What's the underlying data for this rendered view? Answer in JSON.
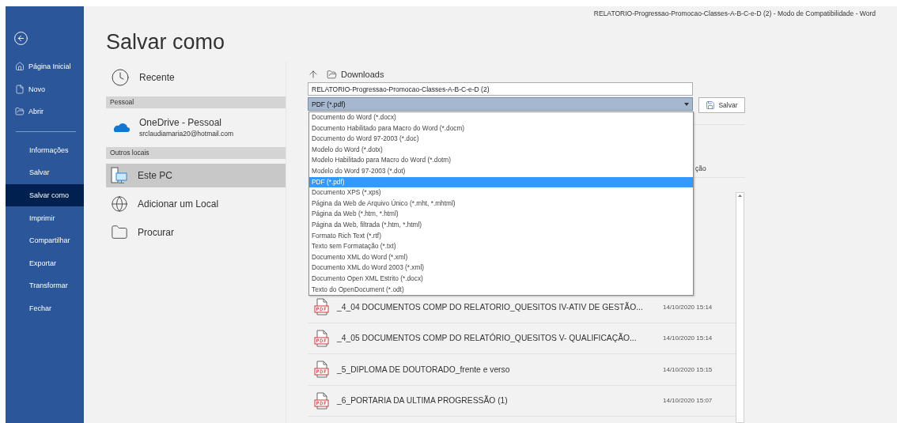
{
  "window": {
    "title": "RELATORIO-Progressao-Promocao-Classes-A-B-C-e-D (2)  -  Modo de Compatibilidade  -  Word"
  },
  "sidebar": {
    "top_items": [
      {
        "label": "Página Inicial",
        "kind": "home"
      },
      {
        "label": "Novo",
        "kind": "new"
      },
      {
        "label": "Abrir",
        "kind": "open"
      }
    ],
    "items": [
      {
        "label": "Informações",
        "selected": false
      },
      {
        "label": "Salvar",
        "selected": false
      },
      {
        "label": "Salvar como",
        "selected": true
      },
      {
        "label": "Imprimir",
        "selected": false
      },
      {
        "label": "Compartilhar",
        "selected": false
      },
      {
        "label": "Exportar",
        "selected": false
      },
      {
        "label": "Transformar",
        "selected": false
      },
      {
        "label": "Fechar",
        "selected": false
      }
    ]
  },
  "page_title": "Salvar como",
  "locations": [
    {
      "kind": "recent",
      "label": "Recente",
      "selected": false
    },
    {
      "kind": "header",
      "label": "Pessoal"
    },
    {
      "kind": "onedrive",
      "label": "OneDrive - Pessoal",
      "sublabel": "srclaudiamaria20@hotmail.com",
      "selected": false
    },
    {
      "kind": "header",
      "label": "Outros locais"
    },
    {
      "kind": "pc",
      "label": "Este PC",
      "selected": true
    },
    {
      "kind": "add",
      "label": "Adicionar um Local",
      "selected": false
    },
    {
      "kind": "browse",
      "label": "Procurar",
      "selected": false
    }
  ],
  "path": {
    "folder": "Downloads"
  },
  "filename": {
    "value": "RELATORIO-Progressao-Promocao-Classes-A-B-C-e-D (2)"
  },
  "file_type": {
    "value": "PDF (*.pdf)",
    "expanded": true,
    "options": [
      {
        "label": "Documento do Word (*.docx)",
        "selected": false
      },
      {
        "label": "Documento Habilitado para Macro do Word (*.docm)",
        "selected": false
      },
      {
        "label": "Documento do Word 97-2003 (*.doc)",
        "selected": false
      },
      {
        "label": "Modelo do Word (*.dotx)",
        "selected": false
      },
      {
        "label": "Modelo Habilitado para Macro do Word (*.dotm)",
        "selected": false
      },
      {
        "label": "Modelo do Word 97-2003 (*.dot)",
        "selected": false
      },
      {
        "label": "PDF (*.pdf)",
        "selected": true
      },
      {
        "label": "Documento XPS (*.xps)",
        "selected": false
      },
      {
        "label": "Página da Web de Arquivo Único (*.mht, *.mhtml)",
        "selected": false
      },
      {
        "label": "Página da Web (*.htm, *.html)",
        "selected": false
      },
      {
        "label": "Página da Web, filtrada (*.htm, *.html)",
        "selected": false
      },
      {
        "label": "Formato Rich Text (*.rtf)",
        "selected": false
      },
      {
        "label": "Texto sem Formatação (*.txt)",
        "selected": false
      },
      {
        "label": "Documento XML do Word (*.xml)",
        "selected": false
      },
      {
        "label": "Documento XML do Word 2003 (*.xml)",
        "selected": false
      },
      {
        "label": "Documento Open XML Estrito (*.docx)",
        "selected": false
      },
      {
        "label": "Texto do OpenDocument (*.odt)",
        "selected": false
      }
    ]
  },
  "save_button": "Salvar",
  "file_list": {
    "column_2": "ção",
    "rows": [
      {
        "kind": "pdf",
        "name": "_4_04 DOCUMENTOS COMP DO RELATORIO_QUESITOS IV-ATIV DE GESTÃO...",
        "modified": "14/10/2020 15:14"
      },
      {
        "kind": "pdf",
        "name": "_4_05  DOCUMENTOS COMP DO RELATÓRIO_QUESITOS V- QUALIFICAÇÃO...",
        "modified": "14/10/2020 15:14"
      },
      {
        "kind": "pdf",
        "name": "_5_DIPLOMA DE DOUTORADO_frente e verso",
        "modified": "14/10/2020 15:15"
      },
      {
        "kind": "pdf",
        "name": "_6_PORTARIA DA ULTIMA PROGRESSÃO (1)",
        "modified": "14/10/2020 15:07"
      }
    ]
  }
}
